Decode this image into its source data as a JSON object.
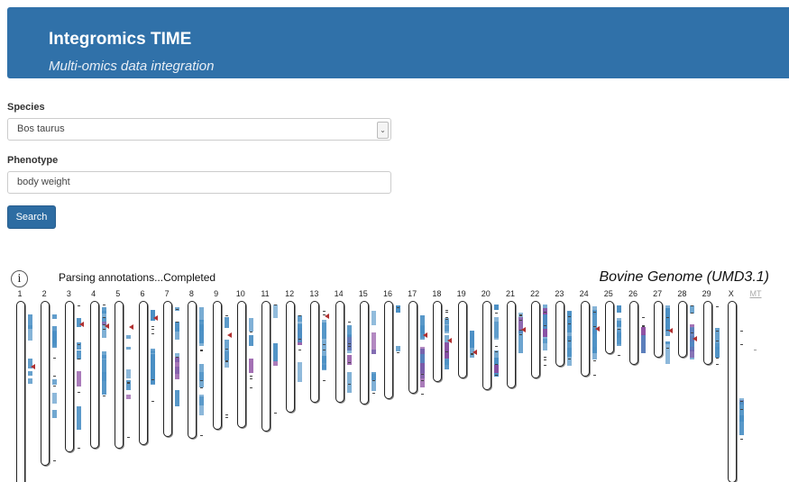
{
  "header": {
    "title": "Integromics TIME",
    "subtitle": "Multi-omics data integration"
  },
  "form": {
    "species_label": "Species",
    "species_value": "Bos taurus",
    "phenotype_label": "Phenotype",
    "phenotype_value": "body weight",
    "search_label": "Search"
  },
  "results": {
    "info_glyph": "i",
    "status": "Parsing annotations...Completed",
    "genome_title": "Bovine Genome (UMD3.1)"
  },
  "colors": {
    "header_bg": "#3071a9",
    "button_bg": "#2d6ca2",
    "band_blue": "#4a8fc4",
    "band_purple": "#8a4aa0",
    "arrow_red": "#b03030"
  },
  "chromosomes": [
    {
      "label": "1",
      "rel_length": 1.0
    },
    {
      "label": "2",
      "rel_length": 0.86
    },
    {
      "label": "3",
      "rel_length": 0.79
    },
    {
      "label": "4",
      "rel_length": 0.77
    },
    {
      "label": "5",
      "rel_length": 0.77
    },
    {
      "label": "6",
      "rel_length": 0.75
    },
    {
      "label": "7",
      "rel_length": 0.71
    },
    {
      "label": "8",
      "rel_length": 0.72
    },
    {
      "label": "9",
      "rel_length": 0.67
    },
    {
      "label": "10",
      "rel_length": 0.66
    },
    {
      "label": "11",
      "rel_length": 0.68
    },
    {
      "label": "12",
      "rel_length": 0.58
    },
    {
      "label": "13",
      "rel_length": 0.53
    },
    {
      "label": "14",
      "rel_length": 0.53
    },
    {
      "label": "15",
      "rel_length": 0.54
    },
    {
      "label": "16",
      "rel_length": 0.51
    },
    {
      "label": "17",
      "rel_length": 0.48
    },
    {
      "label": "18",
      "rel_length": 0.42
    },
    {
      "label": "19",
      "rel_length": 0.4
    },
    {
      "label": "20",
      "rel_length": 0.46
    },
    {
      "label": "21",
      "rel_length": 0.45
    },
    {
      "label": "22",
      "rel_length": 0.4
    },
    {
      "label": "23",
      "rel_length": 0.34
    },
    {
      "label": "24",
      "rel_length": 0.39
    },
    {
      "label": "25",
      "rel_length": 0.27
    },
    {
      "label": "26",
      "rel_length": 0.33
    },
    {
      "label": "27",
      "rel_length": 0.29
    },
    {
      "label": "28",
      "rel_length": 0.29
    },
    {
      "label": "29",
      "rel_length": 0.33
    },
    {
      "label": "X",
      "rel_length": 0.95
    },
    {
      "label": "MT",
      "rel_length": 0.0,
      "dim": true
    }
  ]
}
